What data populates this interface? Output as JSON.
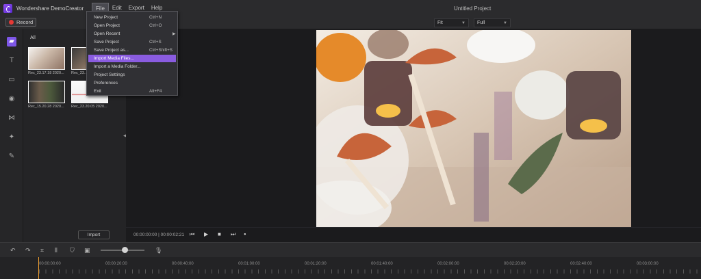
{
  "app": {
    "title": "Wondershare DemoCreator",
    "project_title": "Untitled Project"
  },
  "menubar": {
    "items": [
      "File",
      "Edit",
      "Export",
      "Help"
    ]
  },
  "toolbar": {
    "record_label": "Record",
    "fit_select": "Fit",
    "quality_select": "Full"
  },
  "file_menu": {
    "items": [
      {
        "label": "New Project",
        "shortcut": "Ctrl+N"
      },
      {
        "label": "Open Project",
        "shortcut": "Ctrl+O"
      },
      {
        "label": "Open Recent",
        "shortcut": ""
      },
      {
        "label": "Save Project",
        "shortcut": "Ctrl+S"
      },
      {
        "label": "Save Project as...",
        "shortcut": "Ctrl+Shift+S"
      },
      {
        "label": "Import Media Files...",
        "shortcut": ""
      },
      {
        "label": "Import a Media Folder...",
        "shortcut": ""
      },
      {
        "label": "Project Settings",
        "shortcut": ""
      },
      {
        "label": "Preferences",
        "shortcut": ""
      },
      {
        "label": "Exit",
        "shortcut": "Alt+F4"
      }
    ],
    "highlighted_index": 5
  },
  "media": {
    "tab": "All",
    "items": [
      {
        "label": "Rec_23.17.18 2020..."
      },
      {
        "label": "Rec_23..."
      },
      {
        "label": "Rec_15.20.28 2020..."
      },
      {
        "label": "Rec_23.20.05 2020..."
      }
    ],
    "import_label": "Import"
  },
  "transport": {
    "time_code": "00:00:00:00 | 00:00:02:21"
  },
  "ruler": {
    "labels": [
      "00:00:00:00",
      "00:00:20:00",
      "00:00:40:00",
      "00:01:00:00",
      "00:01:20:00",
      "00:01:40:00",
      "00:02:00:00",
      "00:02:20:00",
      "00:02:40:00",
      "00:03:00:00"
    ]
  }
}
